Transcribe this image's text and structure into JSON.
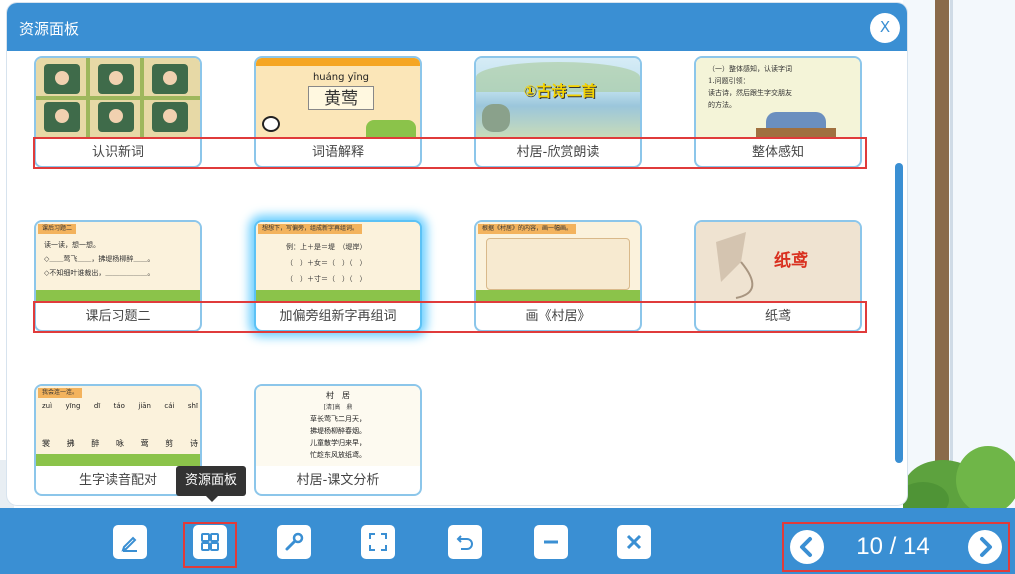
{
  "panel": {
    "title": "资源面板",
    "close_label": "X"
  },
  "cards": [
    {
      "label": "认识新词",
      "thumb": "characters-illustration"
    },
    {
      "label": "词语解释",
      "thumb": "huangying-card",
      "pinyin": "huáng yīng",
      "hanzi": "黄莺"
    },
    {
      "label": "村居-欣赏朗读",
      "thumb": "landscape-title",
      "title": "①古诗二首"
    },
    {
      "label": "整体感知",
      "thumb": "classroom-text",
      "lines": [
        "（一）整体感知，认读字词",
        "1.问题引领：",
        "读古诗，然后跟生字交朋友",
        "的方法。"
      ]
    },
    {
      "label": "课后习题二",
      "thumb": "exercise-sheet",
      "header": "课后习题二",
      "lines": [
        "读一读，想一想。",
        "◇＿＿莺飞＿＿，拂堤杨柳醉＿＿。",
        "◇不知细叶谁裁出，＿＿＿＿＿＿。"
      ]
    },
    {
      "label": "加偏旁组新字再组词",
      "thumb": "radical-exercise",
      "header": "想想下，写偏旁，组成新字再组词。",
      "lines": [
        "例：上＋是＝堤　（堤岸）",
        "（　）＋女＝（　）（　）",
        "（　）＋寸＝（　）（　）"
      ]
    },
    {
      "label": "画《村居》",
      "thumb": "drawing-scroll",
      "header": "根据《村居》的内容，画一幅画。"
    },
    {
      "label": "纸鸢",
      "thumb": "kite-image",
      "title": "纸鸢"
    },
    {
      "label": "生字读音配对",
      "thumb": "pinyin-match",
      "header": "我会连一连。",
      "pinyin": [
        "zuì",
        "yīng",
        "dī",
        "táo",
        "jiān",
        "cái",
        "shī"
      ],
      "hanzi": [
        "裳",
        "拂",
        "醉",
        "咏",
        "莺",
        "剪",
        "诗"
      ]
    },
    {
      "label": "村居-课文分析",
      "thumb": "poem-text",
      "poem_title": "村　居",
      "author": "[清]高　鼎",
      "lines": [
        "草长莺飞二月天，",
        "拂堤杨柳醉春烟。",
        "儿童散学归来早，",
        "忙趁东风放纸鸢。"
      ]
    }
  ],
  "tooltip": "资源面板",
  "toolbar": {
    "tools": [
      "pen-icon",
      "grid-icon",
      "tools-icon",
      "fullscreen-icon",
      "undo-icon",
      "minimize-icon",
      "close-icon"
    ]
  },
  "pager": {
    "text": "10 / 14"
  },
  "colors": {
    "accent": "#3a8fd3",
    "highlight": "#e03b3b",
    "active_glow": "#6fd0ff"
  }
}
